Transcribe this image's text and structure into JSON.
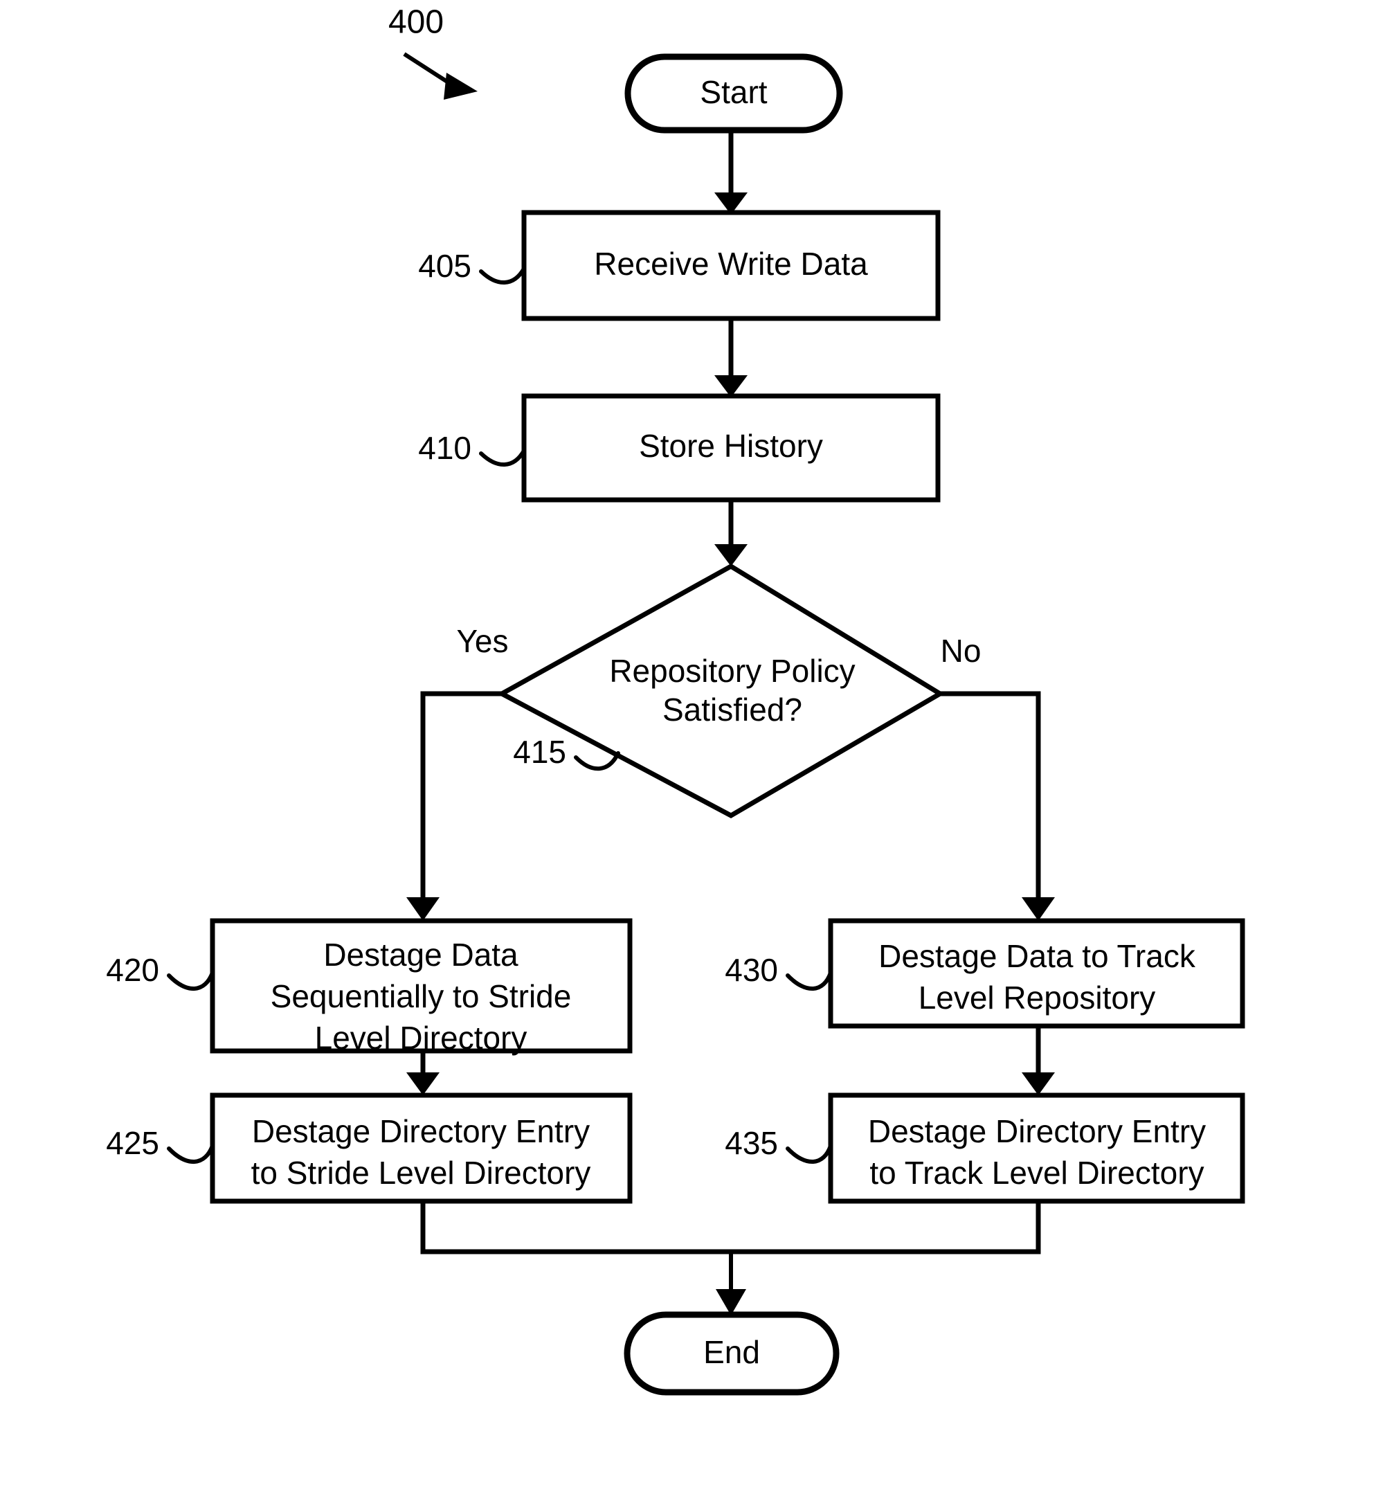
{
  "figure": {
    "number": "400",
    "caption_position": "top-left"
  },
  "nodes": {
    "start": {
      "label": "Start",
      "shape": "terminator"
    },
    "end": {
      "label": "End",
      "shape": "terminator"
    },
    "step405": {
      "ref": "405",
      "label": "Receive Write Data",
      "shape": "process"
    },
    "step410": {
      "ref": "410",
      "label": "Store History",
      "shape": "process"
    },
    "decision415": {
      "ref": "415",
      "label_line1": "Repository Policy",
      "label_line2": "Satisfied?",
      "shape": "decision"
    },
    "step420": {
      "ref": "420",
      "label_line1": "Destage Data",
      "label_line2": "Sequentially to Stride",
      "label_line3": "Level Directory",
      "shape": "process"
    },
    "step425": {
      "ref": "425",
      "label_line1": "Destage Directory Entry",
      "label_line2": "to Stride Level Directory",
      "shape": "process"
    },
    "step430": {
      "ref": "430",
      "label_line1": "Destage Data to Track",
      "label_line2": "Level Repository",
      "shape": "process"
    },
    "step435": {
      "ref": "435",
      "label_line1": "Destage Directory Entry",
      "label_line2": "to Track Level Directory",
      "shape": "process"
    }
  },
  "branches": {
    "yes": "Yes",
    "no": "No"
  },
  "colors": {
    "stroke": "#000000",
    "fill": "#ffffff",
    "text": "#000000"
  }
}
